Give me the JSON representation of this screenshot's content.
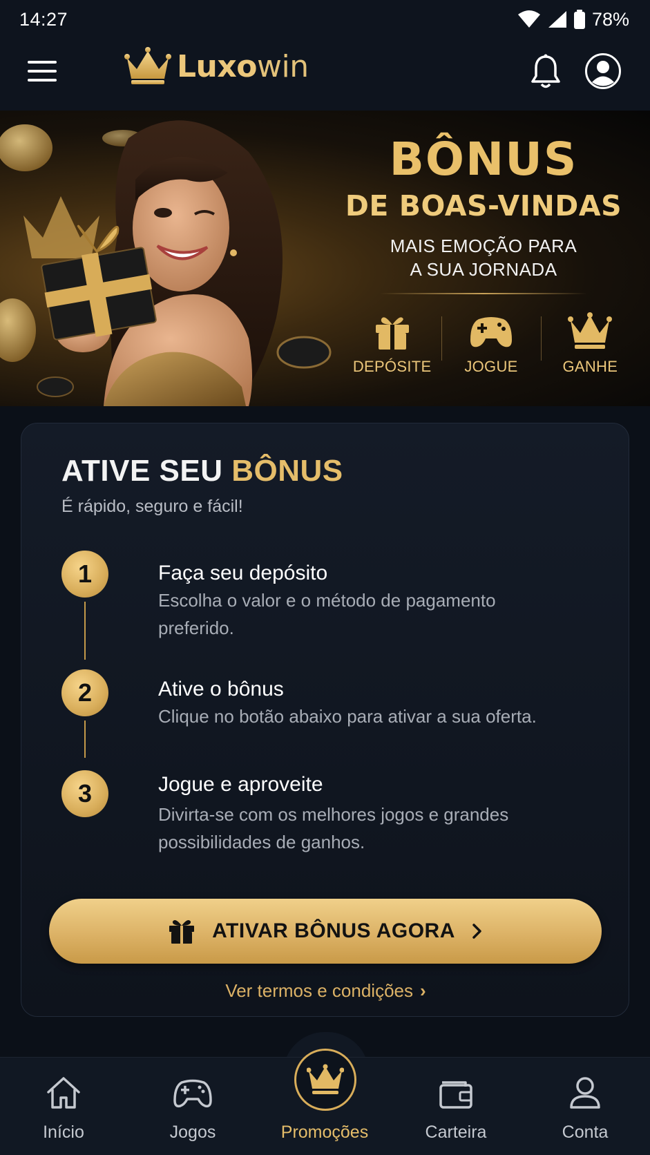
{
  "status_bar": {
    "time": "14:27",
    "battery": "78%"
  },
  "header": {
    "brand_prefix": "Luxo",
    "brand_suffix": "win"
  },
  "hero": {
    "title": "BÔNUS",
    "subtitle": "DE BOAS-VINDAS",
    "tagline_line1": "MAIS EMOÇÃO PARA",
    "tagline_line2": "A SUA JORNADA",
    "steps": [
      {
        "label": "DEPÓSITE",
        "icon": "gift-icon"
      },
      {
        "label": "JOGUE",
        "icon": "gamepad-icon"
      },
      {
        "label": "GANHE",
        "icon": "crown-icon"
      }
    ]
  },
  "card": {
    "title_white": "ATIVE SEU ",
    "title_gold": "BÔNUS",
    "subtitle": "É rápido, seguro e fácil!",
    "steps": [
      {
        "number": "1",
        "title": "Faça seu depósito",
        "description": "Escolha o valor e o método de pagamento preferido."
      },
      {
        "number": "2",
        "title": "Ative o bônus",
        "description": "Clique no botão abaixo para ativar a sua oferta."
      },
      {
        "number": "3",
        "title": "Jogue e aproveite",
        "description": "Divirta-se com os melhores jogos e grandes possibilidades de ganhos."
      }
    ],
    "cta_label": "ATIVAR BÔNUS AGORA",
    "terms_label": "Ver termos e condições"
  },
  "bottom_nav": {
    "items": [
      {
        "label": "Início",
        "icon": "home-icon"
      },
      {
        "label": "Jogos",
        "icon": "gamepad-icon"
      },
      {
        "label": "Promoções",
        "icon": "crown-icon",
        "active": true
      },
      {
        "label": "Carteira",
        "icon": "wallet-icon"
      },
      {
        "label": "Conta",
        "icon": "user-icon"
      }
    ]
  },
  "colors": {
    "gold": "#e5bd6a",
    "background": "#0b1018",
    "card": "#141b27"
  }
}
